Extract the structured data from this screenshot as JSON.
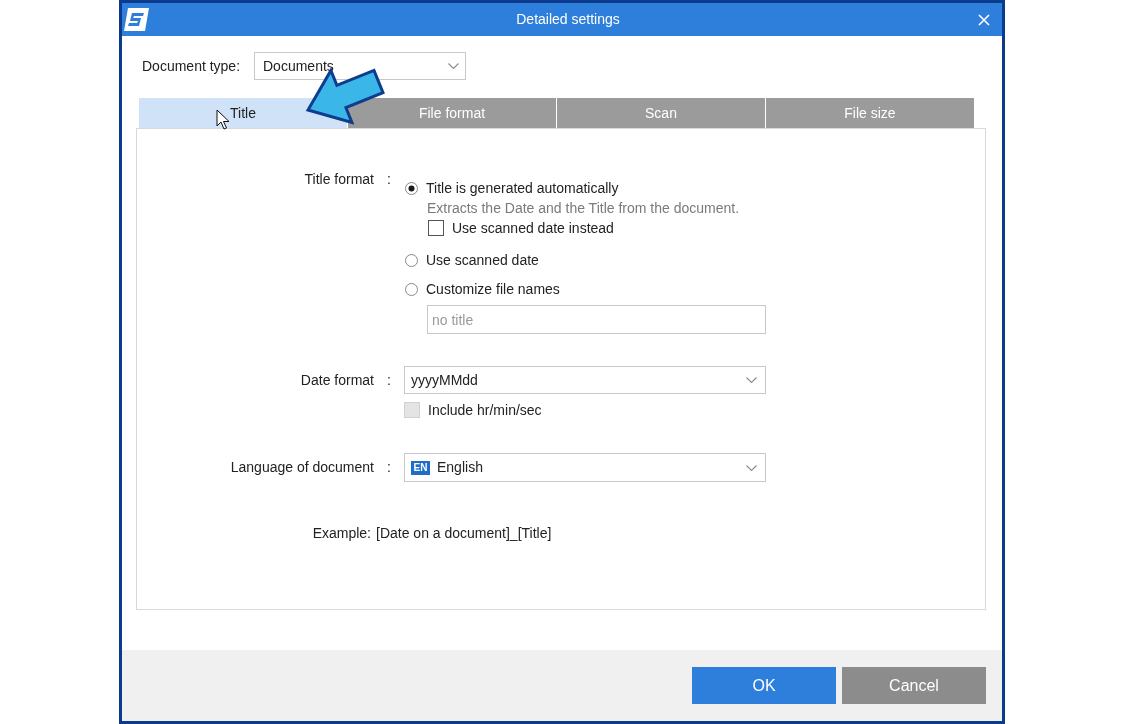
{
  "window": {
    "title": "Detailed settings"
  },
  "document_type": {
    "label": "Document type:",
    "value": "Documents"
  },
  "tabs": [
    {
      "label": "Title",
      "selected": true
    },
    {
      "label": "File format",
      "selected": false
    },
    {
      "label": "Scan",
      "selected": false
    },
    {
      "label": "File size",
      "selected": false
    }
  ],
  "title_format": {
    "label": "Title format",
    "separator": ":",
    "options": [
      {
        "label": "Title is generated automatically",
        "selected": true,
        "description": "Extracts the Date and the Title from the document.",
        "checkbox": {
          "label": "Use scanned date instead",
          "checked": false
        }
      },
      {
        "label": "Use scanned date",
        "selected": false
      },
      {
        "label": "Customize file names",
        "selected": false,
        "field": {
          "placeholder": "no title"
        }
      }
    ]
  },
  "date_format": {
    "label": "Date format",
    "separator": ":",
    "value": "yyyyMMdd",
    "checkbox": {
      "label": "Include hr/min/sec",
      "checked": false,
      "disabled": true
    }
  },
  "language": {
    "label": "Language of document",
    "separator": ":",
    "code": "EN",
    "value": "English"
  },
  "example": {
    "label": "Example:",
    "value": "[Date on a document]_[Title]"
  },
  "buttons": [
    {
      "label": "OK",
      "kind": "primary"
    },
    {
      "label": "Cancel",
      "kind": "secondary"
    }
  ]
}
